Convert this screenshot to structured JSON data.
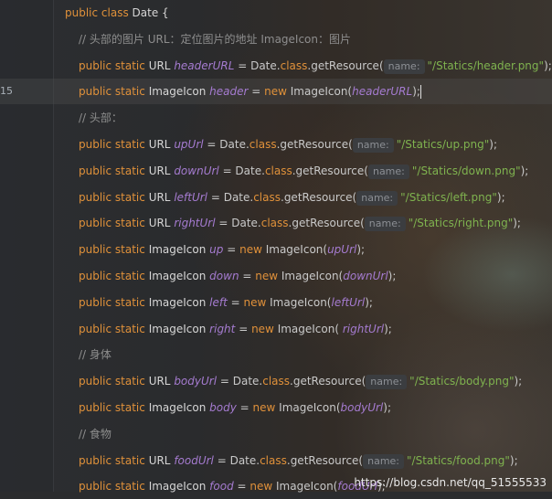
{
  "editor": {
    "current_line_number": "15",
    "lines": [
      {
        "n": "",
        "class_decl": "Date {"
      },
      {
        "n": "",
        "comment": "// 头部的图片 URL：定位图片的地址 ImageIcon：图片"
      },
      {
        "n": "",
        "type": "URL",
        "field": "headerURL",
        "eq": " = Date.",
        "cls": "class",
        "call": ".getResource(",
        "hint": "name:",
        "arg": "\"/Statics/header.png\"",
        "end": ");"
      },
      {
        "n": "15",
        "type": "ImageIcon",
        "field": "header",
        "eq": " = ",
        "new": "new",
        "ctor": " ImageIcon(",
        "ctor_arg": "headerURL",
        "ctor_end": ");"
      },
      {
        "n": "",
        "comment": "// 头部："
      },
      {
        "n": "",
        "type": "URL",
        "field": "upUrl",
        "eq": " = Date.",
        "cls": "class",
        "call": ".getResource(",
        "hint": "name:",
        "arg": "\"/Statics/up.png\"",
        "end": ");"
      },
      {
        "n": "",
        "type": "URL",
        "field": "downUrl",
        "eq": " = Date.",
        "cls": "class",
        "call": ".getResource(",
        "hint": "name:",
        "arg": "\"/Statics/down.png\"",
        "end": ");"
      },
      {
        "n": "",
        "type": "URL",
        "field": "leftUrl",
        "eq": " = Date.",
        "cls": "class",
        "call": ".getResource(",
        "hint": "name:",
        "arg": "\"/Statics/left.png\"",
        "end": ");"
      },
      {
        "n": "",
        "type": "URL",
        "field": "rightUrl",
        "eq": " = Date.",
        "cls": "class",
        "call": ".getResource(",
        "hint": "name:",
        "arg": "\"/Statics/right.png\"",
        "end": ");"
      },
      {
        "n": "",
        "type": "ImageIcon",
        "field": "up",
        "eq": " = ",
        "new": "new",
        "ctor": " ImageIcon(",
        "ctor_arg": "upUrl",
        "ctor_end": ");"
      },
      {
        "n": "",
        "type": "ImageIcon",
        "field": "down",
        "eq": " = ",
        "new": "new",
        "ctor": " ImageIcon(",
        "ctor_arg": "downUrl",
        "ctor_end": ");"
      },
      {
        "n": "",
        "type": "ImageIcon",
        "field": "left",
        "eq": " = ",
        "new": "new",
        "ctor": " ImageIcon(",
        "ctor_arg": "leftUrl",
        "ctor_end": ");"
      },
      {
        "n": "",
        "type": "ImageIcon",
        "field": "right",
        "eq": " = ",
        "new": "new",
        "ctor": " ImageIcon( ",
        "ctor_arg": "rightUrl",
        "ctor_end": ");"
      },
      {
        "n": "",
        "comment": "// 身体"
      },
      {
        "n": "",
        "type": "URL",
        "field": "bodyUrl",
        "eq": " = Date.",
        "cls": "class",
        "call": ".getResource(",
        "hint": "name:",
        "arg": "\"/Statics/body.png\"",
        "end": ");"
      },
      {
        "n": "",
        "type": "ImageIcon",
        "field": "body",
        "eq": " = ",
        "new": "new",
        "ctor": " ImageIcon(",
        "ctor_arg": "bodyUrl",
        "ctor_end": ");"
      },
      {
        "n": "",
        "comment": "// 食物"
      },
      {
        "n": "",
        "type": "URL",
        "field": "foodUrl",
        "eq": " = Date.",
        "cls": "class",
        "call": ".getResource(",
        "hint": "name:",
        "arg": "\"/Statics/food.png\"",
        "end": ");"
      },
      {
        "n": "",
        "type": "ImageIcon",
        "field": "food",
        "eq": " = ",
        "new": "new",
        "ctor": " ImageIcon(",
        "ctor_arg": "foodUrl",
        "ctor_end": ");"
      }
    ],
    "keywords": {
      "public": "public",
      "static": "static",
      "class": "class"
    }
  },
  "watermark": "https://blog.csdn.net/qq_51555533",
  "colors": {
    "keyword": "#e0913a",
    "field": "#a57bd0",
    "string": "#7fb34f",
    "comment": "#8e8e8e",
    "text": "#c9c9c9"
  }
}
